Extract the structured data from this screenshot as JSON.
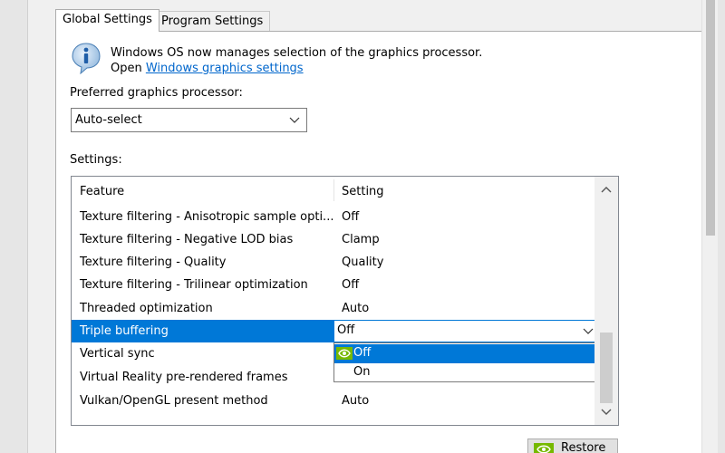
{
  "tabs": [
    {
      "label": "Global Settings",
      "active": true
    },
    {
      "label": "Program Settings",
      "active": false
    }
  ],
  "info": {
    "line1": "Windows OS now manages selection of the graphics processor.",
    "line2_prefix": "Open ",
    "link_text": "Windows graphics settings"
  },
  "preferred": {
    "label": "Preferred graphics processor:",
    "value": "Auto-select"
  },
  "settings": {
    "label": "Settings:",
    "headers": {
      "feature": "Feature",
      "setting": "Setting"
    },
    "rows": [
      {
        "feature": "Texture filtering - Anisotropic sample opti...",
        "setting": "Off"
      },
      {
        "feature": "Texture filtering - Negative LOD bias",
        "setting": "Clamp"
      },
      {
        "feature": "Texture filtering - Quality",
        "setting": "Quality"
      },
      {
        "feature": "Texture filtering - Trilinear optimization",
        "setting": "Off"
      },
      {
        "feature": "Threaded optimization",
        "setting": "Auto"
      },
      {
        "feature": "Triple buffering",
        "setting": "Off",
        "selected": true
      },
      {
        "feature": "Vertical sync",
        "setting": ""
      },
      {
        "feature": "Virtual Reality pre-rendered frames",
        "setting": ""
      },
      {
        "feature": "Vulkan/OpenGL present method",
        "setting": "Auto"
      }
    ],
    "dropdown_options": [
      "Off",
      "On"
    ]
  },
  "buttons": {
    "restore": "Restore"
  },
  "colors": {
    "selection": "#0078d7",
    "link": "#0066cc",
    "nvidia_green": "#76b900"
  }
}
